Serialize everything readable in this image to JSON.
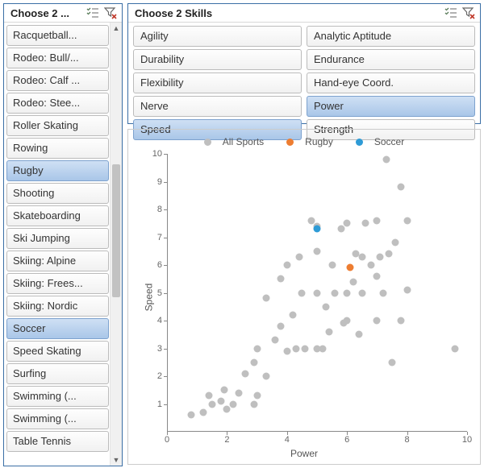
{
  "left": {
    "title": "Choose 2 ...",
    "items": [
      {
        "label": "Racquetball...",
        "selected": false
      },
      {
        "label": "Rodeo: Bull/...",
        "selected": false
      },
      {
        "label": "Rodeo: Calf ...",
        "selected": false
      },
      {
        "label": "Rodeo: Stee...",
        "selected": false
      },
      {
        "label": "Roller Skating",
        "selected": false
      },
      {
        "label": "Rowing",
        "selected": false
      },
      {
        "label": "Rugby",
        "selected": true
      },
      {
        "label": "Shooting",
        "selected": false
      },
      {
        "label": "Skateboarding",
        "selected": false
      },
      {
        "label": "Ski Jumping",
        "selected": false
      },
      {
        "label": "Skiing: Alpine",
        "selected": false
      },
      {
        "label": "Skiing: Frees...",
        "selected": false
      },
      {
        "label": "Skiing: Nordic",
        "selected": false
      },
      {
        "label": "Soccer",
        "selected": true
      },
      {
        "label": "Speed Skating",
        "selected": false
      },
      {
        "label": "Surfing",
        "selected": false
      },
      {
        "label": "Swimming (...",
        "selected": false
      },
      {
        "label": "Swimming (...",
        "selected": false
      },
      {
        "label": "Table Tennis",
        "selected": false
      }
    ]
  },
  "skills": {
    "title": "Choose 2 Skills",
    "items": [
      {
        "label": "Agility",
        "selected": false
      },
      {
        "label": "Analytic Aptitude",
        "selected": false
      },
      {
        "label": "Durability",
        "selected": false
      },
      {
        "label": "Endurance",
        "selected": false
      },
      {
        "label": "Flexibility",
        "selected": false
      },
      {
        "label": "Hand-eye Coord.",
        "selected": false
      },
      {
        "label": "Nerve",
        "selected": false
      },
      {
        "label": "Power",
        "selected": true
      },
      {
        "label": "Speed",
        "selected": true
      },
      {
        "label": "Strength",
        "selected": false
      }
    ]
  },
  "chart_data": {
    "type": "scatter",
    "xlabel": "Power",
    "ylabel": "Speed",
    "xlim": [
      0,
      10
    ],
    "ylim": [
      0,
      10
    ],
    "series": [
      {
        "name": "All Sports",
        "color": "#bfbfbf",
        "points": [
          [
            0.8,
            0.6
          ],
          [
            1.2,
            0.7
          ],
          [
            1.4,
            1.3
          ],
          [
            1.5,
            1.0
          ],
          [
            1.8,
            1.1
          ],
          [
            1.9,
            1.5
          ],
          [
            2.0,
            0.8
          ],
          [
            2.2,
            1.0
          ],
          [
            2.4,
            1.4
          ],
          [
            2.9,
            1.0
          ],
          [
            2.6,
            2.1
          ],
          [
            2.9,
            2.5
          ],
          [
            3.0,
            1.3
          ],
          [
            3.0,
            3.0
          ],
          [
            3.3,
            2.0
          ],
          [
            3.3,
            4.8
          ],
          [
            3.6,
            3.3
          ],
          [
            3.8,
            3.8
          ],
          [
            3.8,
            5.5
          ],
          [
            4.0,
            2.9
          ],
          [
            4.0,
            6.0
          ],
          [
            4.2,
            4.2
          ],
          [
            4.3,
            3.0
          ],
          [
            4.4,
            6.3
          ],
          [
            4.5,
            5.0
          ],
          [
            4.6,
            3.0
          ],
          [
            4.8,
            7.6
          ],
          [
            5.0,
            3.0
          ],
          [
            5.0,
            5.0
          ],
          [
            5.0,
            6.5
          ],
          [
            5.0,
            7.4
          ],
          [
            5.2,
            3.0
          ],
          [
            5.3,
            4.5
          ],
          [
            5.4,
            3.6
          ],
          [
            5.5,
            6.0
          ],
          [
            5.6,
            5.0
          ],
          [
            5.8,
            7.3
          ],
          [
            5.9,
            3.9
          ],
          [
            6.0,
            4.0
          ],
          [
            6.0,
            5.0
          ],
          [
            6.0,
            7.5
          ],
          [
            6.2,
            5.4
          ],
          [
            6.3,
            6.4
          ],
          [
            6.4,
            3.5
          ],
          [
            6.5,
            5.0
          ],
          [
            6.5,
            6.3
          ],
          [
            6.6,
            7.5
          ],
          [
            6.8,
            6.0
          ],
          [
            7.0,
            4.0
          ],
          [
            7.0,
            5.6
          ],
          [
            7.0,
            7.6
          ],
          [
            7.1,
            6.3
          ],
          [
            7.2,
            5.0
          ],
          [
            7.3,
            9.8
          ],
          [
            7.4,
            6.4
          ],
          [
            7.5,
            2.5
          ],
          [
            7.6,
            6.8
          ],
          [
            7.8,
            4.0
          ],
          [
            7.8,
            8.8
          ],
          [
            8.0,
            5.1
          ],
          [
            8.0,
            7.6
          ],
          [
            9.6,
            3.0
          ]
        ]
      },
      {
        "name": "Rugby",
        "color": "#ed7d31",
        "points": [
          [
            6.1,
            5.9
          ]
        ]
      },
      {
        "name": "Soccer",
        "color": "#2e9bd6",
        "points": [
          [
            5.0,
            7.3
          ]
        ]
      }
    ]
  }
}
